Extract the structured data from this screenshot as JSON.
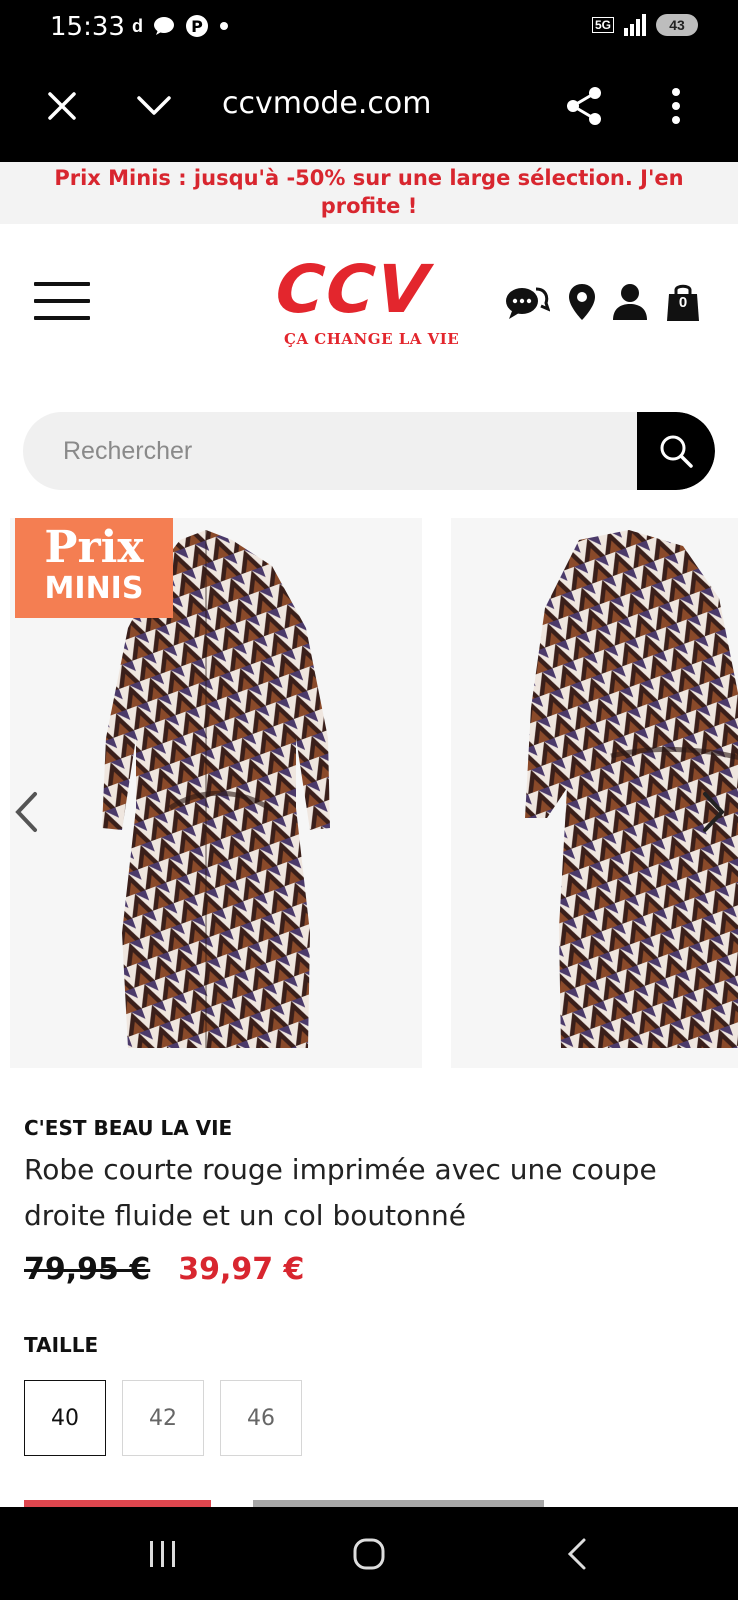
{
  "status_bar": {
    "time": "15:33",
    "network": "5G",
    "battery": "43",
    "left_icons": [
      "notification-d-icon",
      "chat-bubble-icon",
      "pinterest-icon",
      "dot-icon"
    ]
  },
  "browser": {
    "url": "ccvmode.com",
    "icons": [
      "close-icon",
      "chevron-down-icon",
      "share-icon",
      "more-vertical-icon"
    ]
  },
  "promo": {
    "text": "Prix Minis : jusqu'à -50% sur une large sélection. J'en profite !"
  },
  "header": {
    "logo_main": "CCV",
    "logo_tagline": "ÇA CHANGE LA VIE",
    "cart_count": "0",
    "icons": [
      "menu-icon",
      "chat-icon",
      "location-pin-icon",
      "user-icon",
      "shopping-bag-icon"
    ]
  },
  "search": {
    "placeholder": "Rechercher",
    "icon": "search-icon"
  },
  "gallery": {
    "badge_line1": "Prix",
    "badge_line2": "MINIS",
    "images": [
      "dress-front-image",
      "dress-back-image"
    ]
  },
  "product": {
    "brand": "C'EST BEAU LA VIE",
    "title": "Robe courte rouge imprimée avec une coupe droite fluide et un col boutonné",
    "old_price": "79,95 €",
    "new_price": "39,97 €",
    "size_label": "TAILLE",
    "sizes": [
      "40",
      "42",
      "46"
    ],
    "selected_size": "40"
  },
  "colors": {
    "brand_red": "#e3262d",
    "promo_red": "#d8262f",
    "badge_orange": "#f47e52",
    "system_bar": "#000000"
  }
}
